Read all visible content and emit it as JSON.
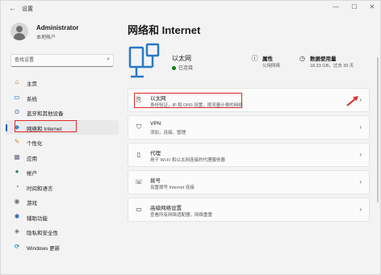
{
  "window": {
    "title": "设置",
    "back_glyph": "←",
    "minimize_glyph": "—",
    "maximize_glyph": "☐",
    "close_glyph": "✕"
  },
  "profile": {
    "name": "Administrator",
    "subtitle": "本地帐户"
  },
  "search": {
    "placeholder": "查找设置"
  },
  "sidebar": {
    "items": [
      {
        "label": "主页",
        "icon": "home-icon",
        "glyph": "⌂",
        "color": "#b06a2b"
      },
      {
        "label": "系统",
        "icon": "system-icon",
        "glyph": "▭",
        "color": "#0a6cc7"
      },
      {
        "label": "蓝牙和其他设备",
        "icon": "bluetooth-icon",
        "glyph": "⊙",
        "color": "#2f5a9c"
      },
      {
        "label": "网络和 Internet",
        "icon": "network-icon",
        "glyph": "◆",
        "color": "#4a7fbd"
      },
      {
        "label": "个性化",
        "icon": "personalization-icon",
        "glyph": "✎",
        "color": "#d88a2b"
      },
      {
        "label": "应用",
        "icon": "apps-icon",
        "glyph": "▦",
        "color": "#6a6a8a"
      },
      {
        "label": "帐户",
        "icon": "accounts-icon",
        "glyph": "●",
        "color": "#2e8b57"
      },
      {
        "label": "时间和语言",
        "icon": "time-language-icon",
        "glyph": "◔",
        "color": "#2a78c8"
      },
      {
        "label": "游戏",
        "icon": "gaming-icon",
        "glyph": "◉",
        "color": "#707070"
      },
      {
        "label": "辅助功能",
        "icon": "accessibility-icon",
        "glyph": "✱",
        "color": "#1b5fb5"
      },
      {
        "label": "隐私和安全性",
        "icon": "privacy-icon",
        "glyph": "◈",
        "color": "#707070"
      },
      {
        "label": "Windows 更新",
        "icon": "windows-update-icon",
        "glyph": "⟳",
        "color": "#0a6cc7"
      }
    ],
    "active_index": 3
  },
  "main": {
    "page_title": "网络和 Internet",
    "connection": {
      "name": "以太网",
      "status": "已连接"
    },
    "properties": {
      "title": "属性",
      "value": "公用网络",
      "icon": "info-icon",
      "glyph": "ⓘ"
    },
    "data_usage": {
      "title": "数据使用量",
      "value": "18.33 GB，过去 30 天",
      "icon": "data-usage-icon",
      "glyph": "◷"
    },
    "cards": [
      {
        "title": "以太网",
        "subtitle": "身份验证，IP 和 DNS 设置，按流量计费的网络",
        "icon": "ethernet-icon",
        "glyph": "⎘"
      },
      {
        "title": "VPN",
        "subtitle": "添加，连接，管理",
        "icon": "vpn-icon",
        "glyph": "⛉"
      },
      {
        "title": "代理",
        "subtitle": "用于 Wi-Fi 和以太网连接的代理服务器",
        "icon": "proxy-icon",
        "glyph": "▯"
      },
      {
        "title": "拨号",
        "subtitle": "设置拨号 Internet 连接",
        "icon": "dialup-icon",
        "glyph": "☏"
      },
      {
        "title": "高级网络设置",
        "subtitle": "查看所有网络适配器，网络重置",
        "icon": "advanced-network-icon",
        "glyph": "▭"
      }
    ],
    "chevron": "›"
  },
  "colors": {
    "accent": "#005fb8",
    "highlight_red": "#e0292b",
    "status_green": "#0f7b0f"
  }
}
